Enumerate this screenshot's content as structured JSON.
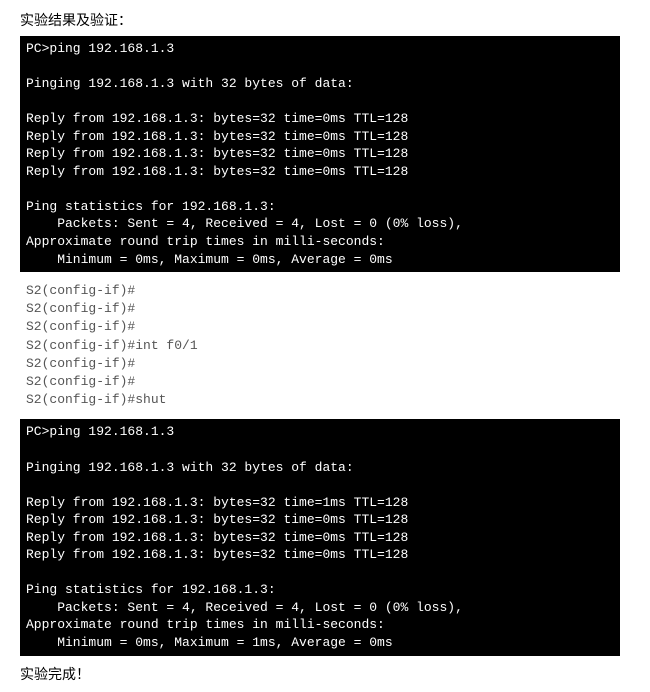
{
  "heading": "实验结果及验证：",
  "terminal1": "PC>ping 192.168.1.3\n\nPinging 192.168.1.3 with 32 bytes of data:\n\nReply from 192.168.1.3: bytes=32 time=0ms TTL=128\nReply from 192.168.1.3: bytes=32 time=0ms TTL=128\nReply from 192.168.1.3: bytes=32 time=0ms TTL=128\nReply from 192.168.1.3: bytes=32 time=0ms TTL=128\n\nPing statistics for 192.168.1.3:\n    Packets: Sent = 4, Received = 4, Lost = 0 (0% loss),\nApproximate round trip times in milli-seconds:\n    Minimum = 0ms, Maximum = 0ms, Average = 0ms",
  "config_block": "S2(config-if)#\nS2(config-if)#\nS2(config-if)#\nS2(config-if)#int f0/1\nS2(config-if)#\nS2(config-if)#\nS2(config-if)#shut",
  "terminal2": "PC>ping 192.168.1.3\n\nPinging 192.168.1.3 with 32 bytes of data:\n\nReply from 192.168.1.3: bytes=32 time=1ms TTL=128\nReply from 192.168.1.3: bytes=32 time=0ms TTL=128\nReply from 192.168.1.3: bytes=32 time=0ms TTL=128\nReply from 192.168.1.3: bytes=32 time=0ms TTL=128\n\nPing statistics for 192.168.1.3:\n    Packets: Sent = 4, Received = 4, Lost = 0 (0% loss),\nApproximate round trip times in milli-seconds:\n    Minimum = 0ms, Maximum = 1ms, Average = 0ms",
  "footer": "实验完成！"
}
